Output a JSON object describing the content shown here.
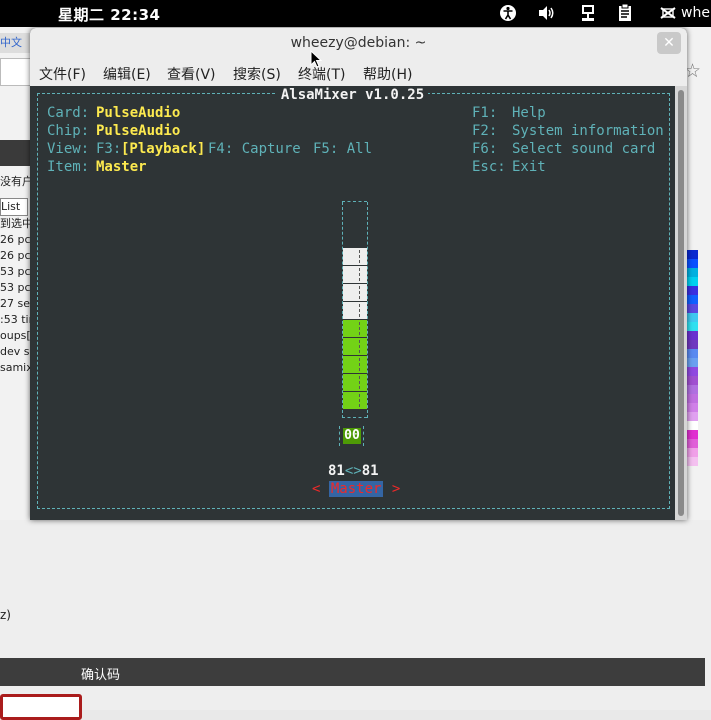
{
  "topbar": {
    "clock": "星期二 22:34",
    "user": "whe",
    "tray_icons": [
      "accessibility-icon",
      "volume-icon",
      "network-icon",
      "clipboard-icon",
      "user-icon"
    ]
  },
  "background": {
    "tab_text": "中文",
    "lines": [
      "没有户",
      "List",
      "到选中",
      "26 pc",
      "26 pc",
      "53 pc",
      "53 pc",
      "27 se",
      ":53 tir",
      "oups[",
      "dev sc",
      "samix"
    ],
    "z_text": "z)",
    "bar_label": "确认码",
    "palette": [
      "#0a2ad0",
      "#0a50ff",
      "#00b0e0",
      "#00d0f0",
      "#3a30e0",
      "#1060ff",
      "#5a4ae0",
      "#40c8f0",
      "#30e0f0",
      "#6a30d0",
      "#7038c0",
      "#5a8af0",
      "#6aa0f0",
      "#9048e0",
      "#a050d0",
      "#b070e0",
      "#c070e0",
      "#d080e8",
      "#e0a0f0",
      "#ffffff",
      "#e030d0",
      "#e060d8",
      "#f0a0e8",
      "#f4c0f0"
    ]
  },
  "terminal": {
    "title": "wheezy@debian: ~",
    "menus": [
      "文件(F)",
      "编辑(E)",
      "查看(V)",
      "搜索(S)",
      "终端(T)",
      "帮助(H)"
    ],
    "alsamixer": {
      "title": "AlsaMixer v1.0.25",
      "card_label": "Card:",
      "card_value": "PulseAudio",
      "chip_label": "Chip:",
      "chip_value": "PulseAudio",
      "view_label": "View:",
      "view_f3": "F3:",
      "view_playback": "[Playback]",
      "view_f4": "F4: Capture",
      "view_f5": "F5: All",
      "item_label": "Item:",
      "item_value": "Master",
      "help": [
        {
          "key": "F1:",
          "text": "Help"
        },
        {
          "key": "F2:",
          "text": "System information"
        },
        {
          "key": "F6:",
          "text": "Select sound card"
        },
        {
          "key": "Esc:",
          "text": "Exit"
        }
      ],
      "mute_state": "00",
      "volume_left": "81",
      "volume_sep": "<>",
      "volume_right": "81",
      "channel_name": "Master",
      "channel_left_bracket": "<",
      "channel_right_bracket": ">",
      "level_fraction": 0.81,
      "segments_total": 9,
      "segments_white": 4
    }
  }
}
